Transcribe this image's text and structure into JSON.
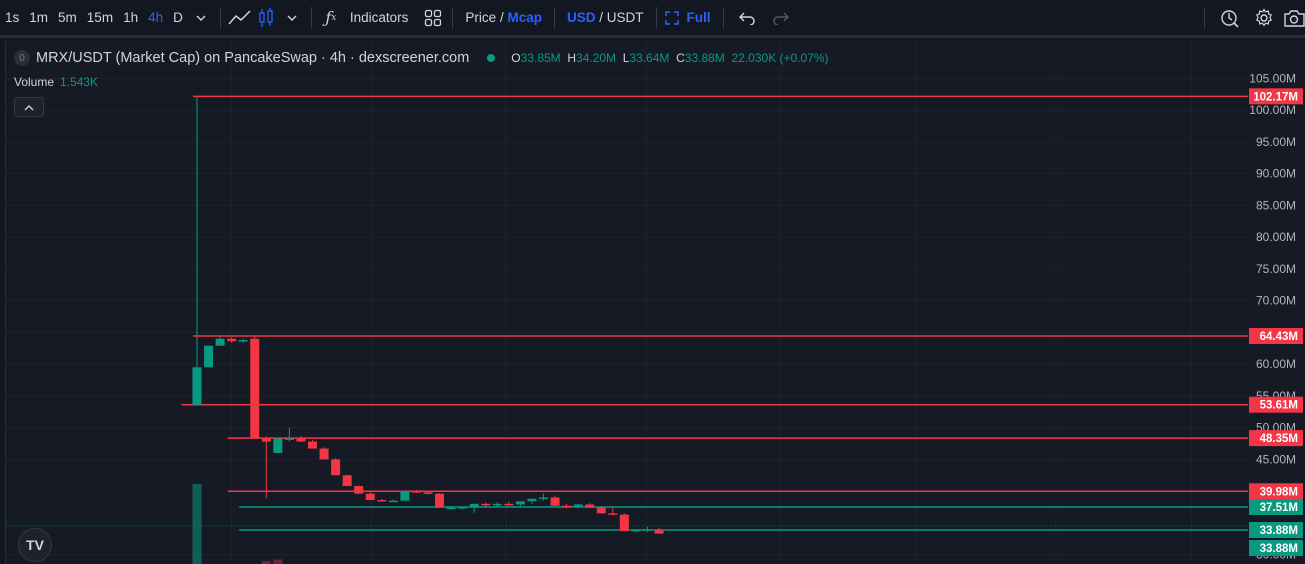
{
  "toolbar": {
    "intervals": [
      "1s",
      "1m",
      "5m",
      "15m",
      "1h",
      "4h",
      "D"
    ],
    "active_interval": "4h",
    "indicators_label": "Indicators",
    "price_label": "Price",
    "price_sep": "/",
    "mcap_label": "Mcap",
    "usd_label": "USD",
    "usd_sep": "/",
    "usdt_label": "USDT",
    "full_label": "Full"
  },
  "legend": {
    "badge": "0",
    "symbol": "MRX/USDT (Market Cap) on PancakeSwap · 4h · dexscreener.com",
    "o_label": "O",
    "o_value": "33.85M",
    "h_label": "H",
    "h_value": "34.20M",
    "l_label": "L",
    "l_value": "33.64M",
    "c_label": "C",
    "c_value": "33.88M",
    "change": "22.030K (+0.07%)"
  },
  "volume": {
    "label": "Volume",
    "value": "1.543K"
  },
  "logo_text": "TV",
  "colors": {
    "up": "#089981",
    "down": "#f23645",
    "bg": "#161a25",
    "toolbar_bg": "#131722",
    "accent": "#2962ff"
  },
  "chart_data": {
    "type": "candlestick",
    "y_unit": "M",
    "ylim": [
      29,
      106
    ],
    "y_ticks": [
      30,
      45,
      50,
      55,
      60,
      65,
      70,
      75,
      80,
      85,
      90,
      95,
      100,
      105
    ],
    "grid": true,
    "candles": [
      {
        "o": 53.6,
        "h": 59.5,
        "l": 53.6,
        "c": 59.5
      },
      {
        "o": 59.5,
        "h": 62.9,
        "l": 59.5,
        "c": 62.9
      },
      {
        "o": 62.9,
        "h": 64.4,
        "l": 62.9,
        "c": 64.0
      },
      {
        "o": 64.0,
        "h": 64.2,
        "l": 63.4,
        "c": 63.6
      },
      {
        "o": 63.6,
        "h": 64.0,
        "l": 63.3,
        "c": 63.8
      },
      {
        "o": 64.0,
        "h": 64.4,
        "l": 48.4,
        "c": 48.4
      },
      {
        "o": 48.4,
        "h": 48.6,
        "l": 38.9,
        "c": 47.8
      },
      {
        "o": 46.0,
        "h": 48.3,
        "l": 46.0,
        "c": 48.3
      },
      {
        "o": 48.3,
        "h": 50.0,
        "l": 47.8,
        "c": 48.3
      },
      {
        "o": 48.3,
        "h": 48.7,
        "l": 47.8,
        "c": 47.8
      },
      {
        "o": 47.8,
        "h": 48.1,
        "l": 46.7,
        "c": 46.7
      },
      {
        "o": 46.7,
        "h": 46.9,
        "l": 45.0,
        "c": 45.0
      },
      {
        "o": 45.0,
        "h": 45.2,
        "l": 42.5,
        "c": 42.5
      },
      {
        "o": 42.5,
        "h": 42.6,
        "l": 40.8,
        "c": 40.8
      },
      {
        "o": 40.8,
        "h": 40.9,
        "l": 39.6,
        "c": 39.6
      },
      {
        "o": 39.6,
        "h": 39.8,
        "l": 38.6,
        "c": 38.6
      },
      {
        "o": 38.6,
        "h": 38.8,
        "l": 38.4,
        "c": 38.4
      },
      {
        "o": 38.4,
        "h": 38.7,
        "l": 38.3,
        "c": 38.5
      },
      {
        "o": 38.5,
        "h": 40.1,
        "l": 38.5,
        "c": 40.0
      },
      {
        "o": 40.0,
        "h": 40.2,
        "l": 39.7,
        "c": 39.8
      },
      {
        "o": 39.8,
        "h": 40.1,
        "l": 39.5,
        "c": 39.6
      },
      {
        "o": 39.6,
        "h": 39.7,
        "l": 37.4,
        "c": 37.4
      },
      {
        "o": 37.4,
        "h": 37.6,
        "l": 37.1,
        "c": 37.4
      },
      {
        "o": 37.4,
        "h": 37.6,
        "l": 37.1,
        "c": 37.5
      },
      {
        "o": 37.5,
        "h": 38.0,
        "l": 36.6,
        "c": 38.0
      },
      {
        "o": 38.0,
        "h": 38.2,
        "l": 37.5,
        "c": 37.9
      },
      {
        "o": 37.9,
        "h": 38.3,
        "l": 37.6,
        "c": 38.0
      },
      {
        "o": 38.0,
        "h": 38.4,
        "l": 37.8,
        "c": 37.9
      },
      {
        "o": 37.9,
        "h": 38.4,
        "l": 37.6,
        "c": 38.4
      },
      {
        "o": 38.4,
        "h": 38.9,
        "l": 38.0,
        "c": 38.8
      },
      {
        "o": 38.8,
        "h": 39.6,
        "l": 38.5,
        "c": 39.0
      },
      {
        "o": 39.0,
        "h": 39.3,
        "l": 37.7,
        "c": 37.7
      },
      {
        "o": 37.7,
        "h": 38.0,
        "l": 37.3,
        "c": 37.6
      },
      {
        "o": 37.6,
        "h": 38.0,
        "l": 37.3,
        "c": 37.9
      },
      {
        "o": 37.9,
        "h": 38.1,
        "l": 37.3,
        "c": 37.4
      },
      {
        "o": 37.4,
        "h": 37.6,
        "l": 36.5,
        "c": 36.5
      },
      {
        "o": 36.5,
        "h": 37.5,
        "l": 36.2,
        "c": 36.3
      },
      {
        "o": 36.3,
        "h": 36.5,
        "l": 33.7,
        "c": 33.7
      },
      {
        "o": 33.7,
        "h": 34.0,
        "l": 33.5,
        "c": 33.9
      },
      {
        "o": 33.9,
        "h": 34.4,
        "l": 33.6,
        "c": 34.0
      },
      {
        "o": 33.85,
        "h": 34.2,
        "l": 33.64,
        "c": 33.3
      }
    ],
    "volume_bars": [
      {
        "i": 0,
        "v": 1.0,
        "dir": "up"
      },
      {
        "i": 6,
        "v": 0.06,
        "dir": "down"
      },
      {
        "i": 7,
        "v": 0.08,
        "dir": "down"
      },
      {
        "i": 21,
        "v": 0.02,
        "dir": "down"
      },
      {
        "i": 24,
        "v": 0.02,
        "dir": "up"
      },
      {
        "i": 36,
        "v": 0.02,
        "dir": "down"
      }
    ],
    "levels": [
      {
        "value": 102.17,
        "label": "102.17M",
        "color": "#f23645",
        "start": 0
      },
      {
        "value": 64.43,
        "label": "64.43M",
        "color": "#f23645",
        "start": 0
      },
      {
        "value": 53.61,
        "label": "53.61M",
        "color": "#f23645",
        "start": -1
      },
      {
        "value": 48.35,
        "label": "48.35M",
        "color": "#f23645",
        "start": 3
      },
      {
        "value": 39.98,
        "label": "39.98M",
        "color": "#f23645",
        "start": 3
      },
      {
        "value": 37.51,
        "label": "37.51M",
        "color": "#089981",
        "start": 4
      },
      {
        "value": 33.88,
        "label": "33.88M",
        "color": "#089981",
        "start": 4
      }
    ],
    "price_tag": {
      "value": 33.88,
      "label": "33.88M",
      "color": "#089981"
    },
    "spike_line": {
      "index": 0,
      "to": 102.17
    }
  }
}
